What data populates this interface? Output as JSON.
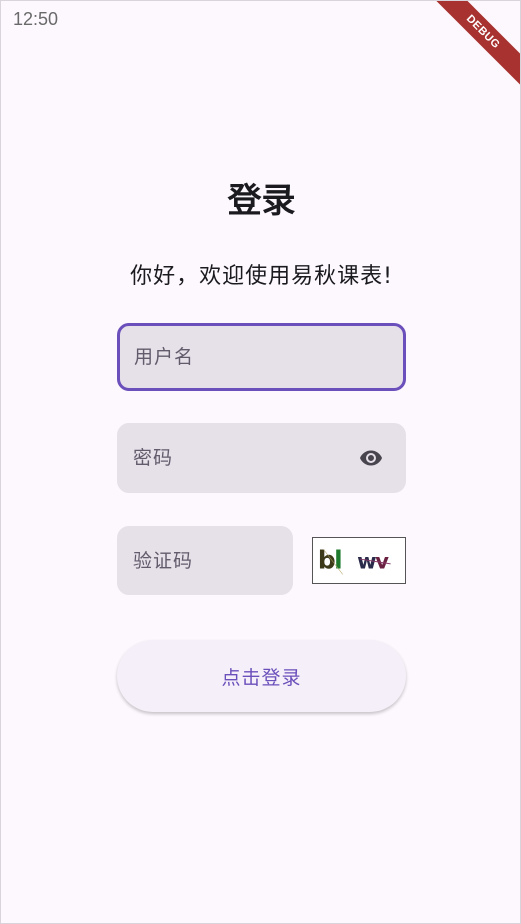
{
  "status_bar": {
    "time": "12:50"
  },
  "debug_banner": {
    "label": "DEBUG"
  },
  "login": {
    "title": "登录",
    "welcome": "你好，欢迎使用易秋课表!",
    "username_placeholder": "用户名",
    "password_placeholder": "密码",
    "captcha_placeholder": "验证码",
    "captcha_image_text": "bl wv",
    "submit_label": "点击登录"
  },
  "colors": {
    "primary": "#6b4fbb",
    "field_background": "#e6e0e9",
    "page_background": "#fdf8fe",
    "debug_banner": "#a8322f"
  },
  "icons": {
    "password_toggle": "eye-icon"
  }
}
